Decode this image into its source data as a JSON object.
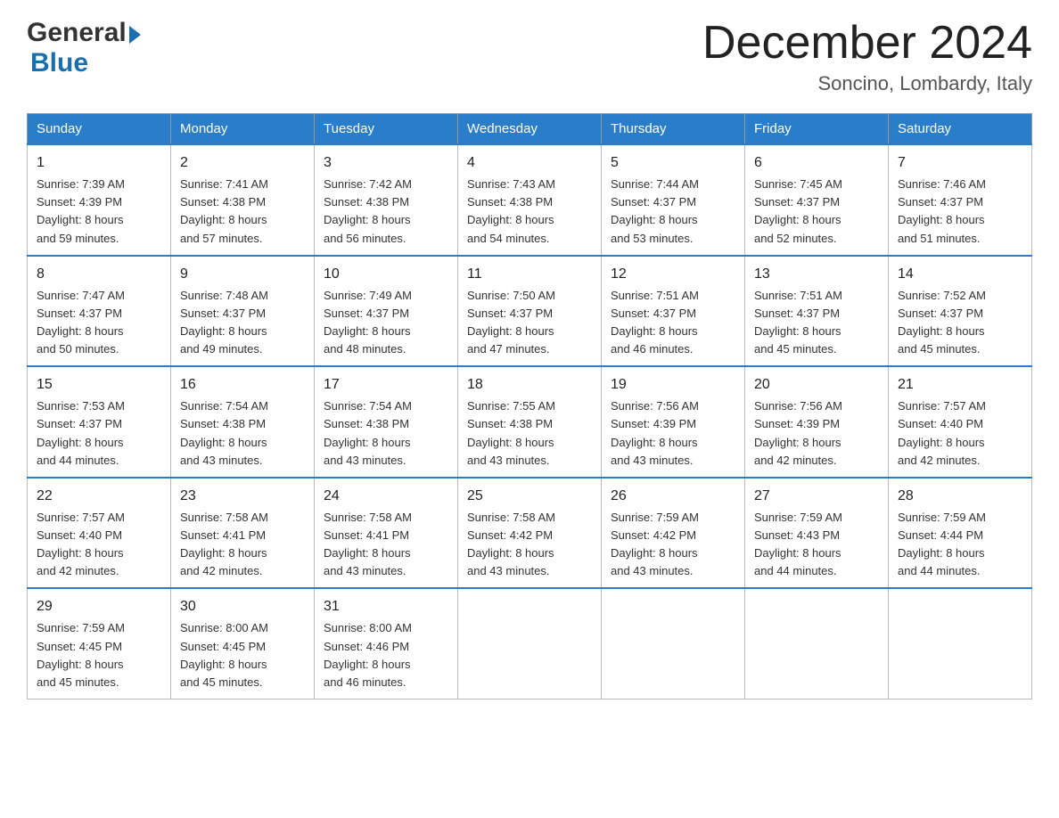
{
  "logo": {
    "general": "General",
    "blue": "Blue",
    "triangle_char": "▶"
  },
  "header": {
    "month_year": "December 2024",
    "location": "Soncino, Lombardy, Italy"
  },
  "weekdays": [
    "Sunday",
    "Monday",
    "Tuesday",
    "Wednesday",
    "Thursday",
    "Friday",
    "Saturday"
  ],
  "weeks": [
    [
      {
        "day": "1",
        "sunrise": "Sunrise: 7:39 AM",
        "sunset": "Sunset: 4:39 PM",
        "daylight": "Daylight: 8 hours",
        "minutes": "and 59 minutes."
      },
      {
        "day": "2",
        "sunrise": "Sunrise: 7:41 AM",
        "sunset": "Sunset: 4:38 PM",
        "daylight": "Daylight: 8 hours",
        "minutes": "and 57 minutes."
      },
      {
        "day": "3",
        "sunrise": "Sunrise: 7:42 AM",
        "sunset": "Sunset: 4:38 PM",
        "daylight": "Daylight: 8 hours",
        "minutes": "and 56 minutes."
      },
      {
        "day": "4",
        "sunrise": "Sunrise: 7:43 AM",
        "sunset": "Sunset: 4:38 PM",
        "daylight": "Daylight: 8 hours",
        "minutes": "and 54 minutes."
      },
      {
        "day": "5",
        "sunrise": "Sunrise: 7:44 AM",
        "sunset": "Sunset: 4:37 PM",
        "daylight": "Daylight: 8 hours",
        "minutes": "and 53 minutes."
      },
      {
        "day": "6",
        "sunrise": "Sunrise: 7:45 AM",
        "sunset": "Sunset: 4:37 PM",
        "daylight": "Daylight: 8 hours",
        "minutes": "and 52 minutes."
      },
      {
        "day": "7",
        "sunrise": "Sunrise: 7:46 AM",
        "sunset": "Sunset: 4:37 PM",
        "daylight": "Daylight: 8 hours",
        "minutes": "and 51 minutes."
      }
    ],
    [
      {
        "day": "8",
        "sunrise": "Sunrise: 7:47 AM",
        "sunset": "Sunset: 4:37 PM",
        "daylight": "Daylight: 8 hours",
        "minutes": "and 50 minutes."
      },
      {
        "day": "9",
        "sunrise": "Sunrise: 7:48 AM",
        "sunset": "Sunset: 4:37 PM",
        "daylight": "Daylight: 8 hours",
        "minutes": "and 49 minutes."
      },
      {
        "day": "10",
        "sunrise": "Sunrise: 7:49 AM",
        "sunset": "Sunset: 4:37 PM",
        "daylight": "Daylight: 8 hours",
        "minutes": "and 48 minutes."
      },
      {
        "day": "11",
        "sunrise": "Sunrise: 7:50 AM",
        "sunset": "Sunset: 4:37 PM",
        "daylight": "Daylight: 8 hours",
        "minutes": "and 47 minutes."
      },
      {
        "day": "12",
        "sunrise": "Sunrise: 7:51 AM",
        "sunset": "Sunset: 4:37 PM",
        "daylight": "Daylight: 8 hours",
        "minutes": "and 46 minutes."
      },
      {
        "day": "13",
        "sunrise": "Sunrise: 7:51 AM",
        "sunset": "Sunset: 4:37 PM",
        "daylight": "Daylight: 8 hours",
        "minutes": "and 45 minutes."
      },
      {
        "day": "14",
        "sunrise": "Sunrise: 7:52 AM",
        "sunset": "Sunset: 4:37 PM",
        "daylight": "Daylight: 8 hours",
        "minutes": "and 45 minutes."
      }
    ],
    [
      {
        "day": "15",
        "sunrise": "Sunrise: 7:53 AM",
        "sunset": "Sunset: 4:37 PM",
        "daylight": "Daylight: 8 hours",
        "minutes": "and 44 minutes."
      },
      {
        "day": "16",
        "sunrise": "Sunrise: 7:54 AM",
        "sunset": "Sunset: 4:38 PM",
        "daylight": "Daylight: 8 hours",
        "minutes": "and 43 minutes."
      },
      {
        "day": "17",
        "sunrise": "Sunrise: 7:54 AM",
        "sunset": "Sunset: 4:38 PM",
        "daylight": "Daylight: 8 hours",
        "minutes": "and 43 minutes."
      },
      {
        "day": "18",
        "sunrise": "Sunrise: 7:55 AM",
        "sunset": "Sunset: 4:38 PM",
        "daylight": "Daylight: 8 hours",
        "minutes": "and 43 minutes."
      },
      {
        "day": "19",
        "sunrise": "Sunrise: 7:56 AM",
        "sunset": "Sunset: 4:39 PM",
        "daylight": "Daylight: 8 hours",
        "minutes": "and 43 minutes."
      },
      {
        "day": "20",
        "sunrise": "Sunrise: 7:56 AM",
        "sunset": "Sunset: 4:39 PM",
        "daylight": "Daylight: 8 hours",
        "minutes": "and 42 minutes."
      },
      {
        "day": "21",
        "sunrise": "Sunrise: 7:57 AM",
        "sunset": "Sunset: 4:40 PM",
        "daylight": "Daylight: 8 hours",
        "minutes": "and 42 minutes."
      }
    ],
    [
      {
        "day": "22",
        "sunrise": "Sunrise: 7:57 AM",
        "sunset": "Sunset: 4:40 PM",
        "daylight": "Daylight: 8 hours",
        "minutes": "and 42 minutes."
      },
      {
        "day": "23",
        "sunrise": "Sunrise: 7:58 AM",
        "sunset": "Sunset: 4:41 PM",
        "daylight": "Daylight: 8 hours",
        "minutes": "and 42 minutes."
      },
      {
        "day": "24",
        "sunrise": "Sunrise: 7:58 AM",
        "sunset": "Sunset: 4:41 PM",
        "daylight": "Daylight: 8 hours",
        "minutes": "and 43 minutes."
      },
      {
        "day": "25",
        "sunrise": "Sunrise: 7:58 AM",
        "sunset": "Sunset: 4:42 PM",
        "daylight": "Daylight: 8 hours",
        "minutes": "and 43 minutes."
      },
      {
        "day": "26",
        "sunrise": "Sunrise: 7:59 AM",
        "sunset": "Sunset: 4:42 PM",
        "daylight": "Daylight: 8 hours",
        "minutes": "and 43 minutes."
      },
      {
        "day": "27",
        "sunrise": "Sunrise: 7:59 AM",
        "sunset": "Sunset: 4:43 PM",
        "daylight": "Daylight: 8 hours",
        "minutes": "and 44 minutes."
      },
      {
        "day": "28",
        "sunrise": "Sunrise: 7:59 AM",
        "sunset": "Sunset: 4:44 PM",
        "daylight": "Daylight: 8 hours",
        "minutes": "and 44 minutes."
      }
    ],
    [
      {
        "day": "29",
        "sunrise": "Sunrise: 7:59 AM",
        "sunset": "Sunset: 4:45 PM",
        "daylight": "Daylight: 8 hours",
        "minutes": "and 45 minutes."
      },
      {
        "day": "30",
        "sunrise": "Sunrise: 8:00 AM",
        "sunset": "Sunset: 4:45 PM",
        "daylight": "Daylight: 8 hours",
        "minutes": "and 45 minutes."
      },
      {
        "day": "31",
        "sunrise": "Sunrise: 8:00 AM",
        "sunset": "Sunset: 4:46 PM",
        "daylight": "Daylight: 8 hours",
        "minutes": "and 46 minutes."
      },
      null,
      null,
      null,
      null
    ]
  ]
}
